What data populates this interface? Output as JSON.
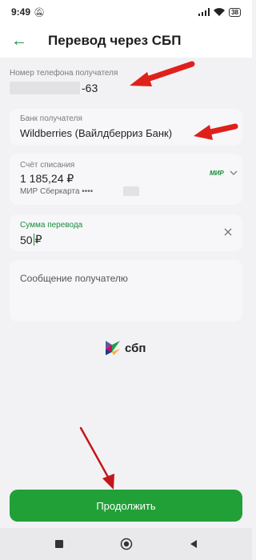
{
  "status_bar": {
    "time": "9:49",
    "battery": "38"
  },
  "header": {
    "title": "Перевод через СБП"
  },
  "phone": {
    "label": "Номер телефона получателя",
    "value_suffix": "-63"
  },
  "bank": {
    "label": "Банк получателя",
    "value": "Wildberries (Вайлдберриз Банк)"
  },
  "account": {
    "label": "Счёт списания",
    "balance": "1 185,24 ₽",
    "card_name": "МИР Сберкарта ••••",
    "payment_system": "МИР"
  },
  "amount": {
    "label": "Сумма перевода",
    "value": "50",
    "currency": "₽"
  },
  "message": {
    "placeholder": "Сообщение получателю"
  },
  "logo": {
    "text": "сбп"
  },
  "actions": {
    "continue_label": "Продолжить"
  },
  "colors": {
    "accent": "#21a038",
    "arrow": "#e0201a"
  }
}
